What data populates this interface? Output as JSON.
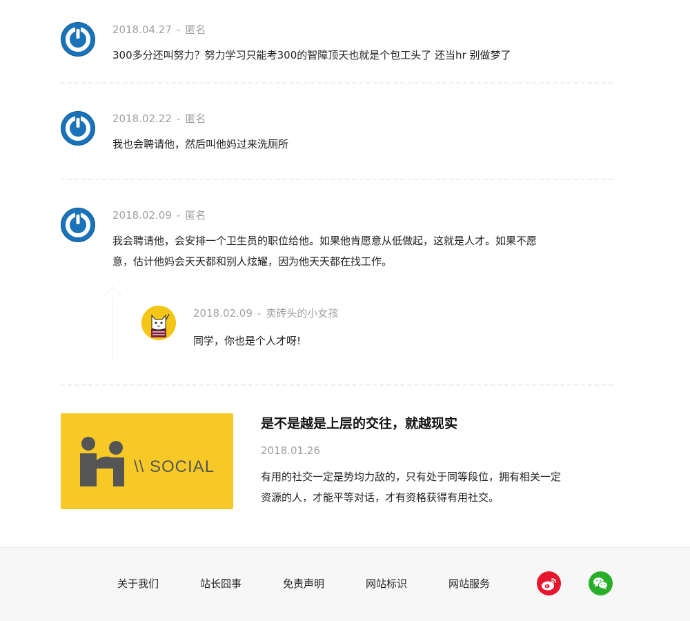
{
  "comments": [
    {
      "date": "2018.04.27",
      "separator": "-",
      "author": "匿名",
      "text": "300多分还叫努力？努力学习只能考300的智障顶天也就是个包工头了 还当hr 别做梦了"
    },
    {
      "date": "2018.02.22",
      "separator": "-",
      "author": "匿名",
      "text": "我也会聘请他，然后叫他妈过来洗厕所"
    },
    {
      "date": "2018.02.09",
      "separator": "-",
      "author": "匿名",
      "text_line1": "我会聘请他，会安排一个卫生员的职位给他。如果他肯愿意从低做起，这就是人才。如果不愿",
      "text_line2": "意，估计他妈会天天都和别人炫耀，因为他天天都在找工作。",
      "reply": {
        "date": "2018.02.09",
        "separator": "-",
        "author": "卖砖头的小女孩",
        "text": "同学，你也是个人才呀!"
      }
    }
  ],
  "article": {
    "thumbnail_text": "\\\\ SOCIAL",
    "title": "是不是越是上层的交往，就越现实",
    "date": "2018.01.26",
    "excerpt_line1": "有用的社交一定是势均力敌的，只有处于同等段位，拥有相关一定",
    "excerpt_line2": "资源的人，才能平等对话，才有资格获得有用社交。"
  },
  "footer": {
    "links": [
      "关于我们",
      "站长囧事",
      "免责声明",
      "网站标识",
      "网站服务"
    ],
    "social": [
      {
        "name": "weibo-icon",
        "color": "#e6162d"
      },
      {
        "name": "wechat-icon",
        "color": "#2aae2a"
      }
    ]
  },
  "colors": {
    "default_avatar": "#1a73b8",
    "thumbnail_bg": "#f7c927",
    "meta_text": "#a0a0a0"
  }
}
